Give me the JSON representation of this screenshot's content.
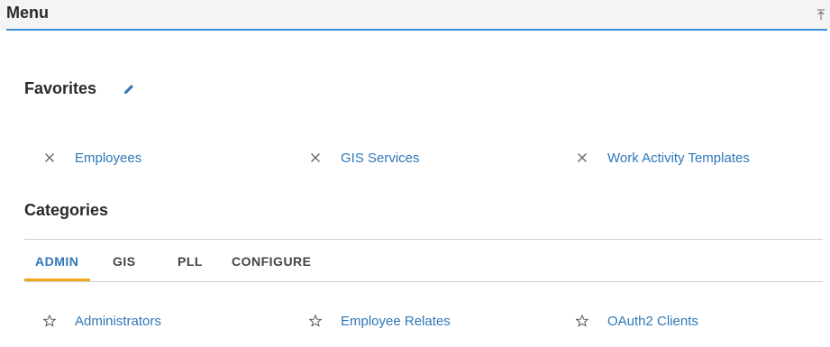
{
  "header": {
    "title": "Menu"
  },
  "favorites": {
    "title": "Favorites",
    "items": [
      {
        "label": "Employees"
      },
      {
        "label": "GIS Services"
      },
      {
        "label": "Work Activity Templates"
      }
    ]
  },
  "categories": {
    "title": "Categories",
    "tabs": [
      {
        "label": "ADMIN"
      },
      {
        "label": "GIS"
      },
      {
        "label": "PLL"
      },
      {
        "label": "CONFIGURE"
      }
    ],
    "active_tab": "ADMIN",
    "items": [
      {
        "label": "Administrators"
      },
      {
        "label": "Employee Relates"
      },
      {
        "label": "OAuth2 Clients"
      }
    ]
  },
  "colors": {
    "accent": "#2f77b8",
    "header_line": "#3b8fd9",
    "tab_underline": "#f2a81d"
  },
  "icons": {
    "collapse": "collapse-up-icon",
    "edit": "pencil-icon",
    "remove": "close-icon",
    "favorite": "star-outline-icon"
  }
}
